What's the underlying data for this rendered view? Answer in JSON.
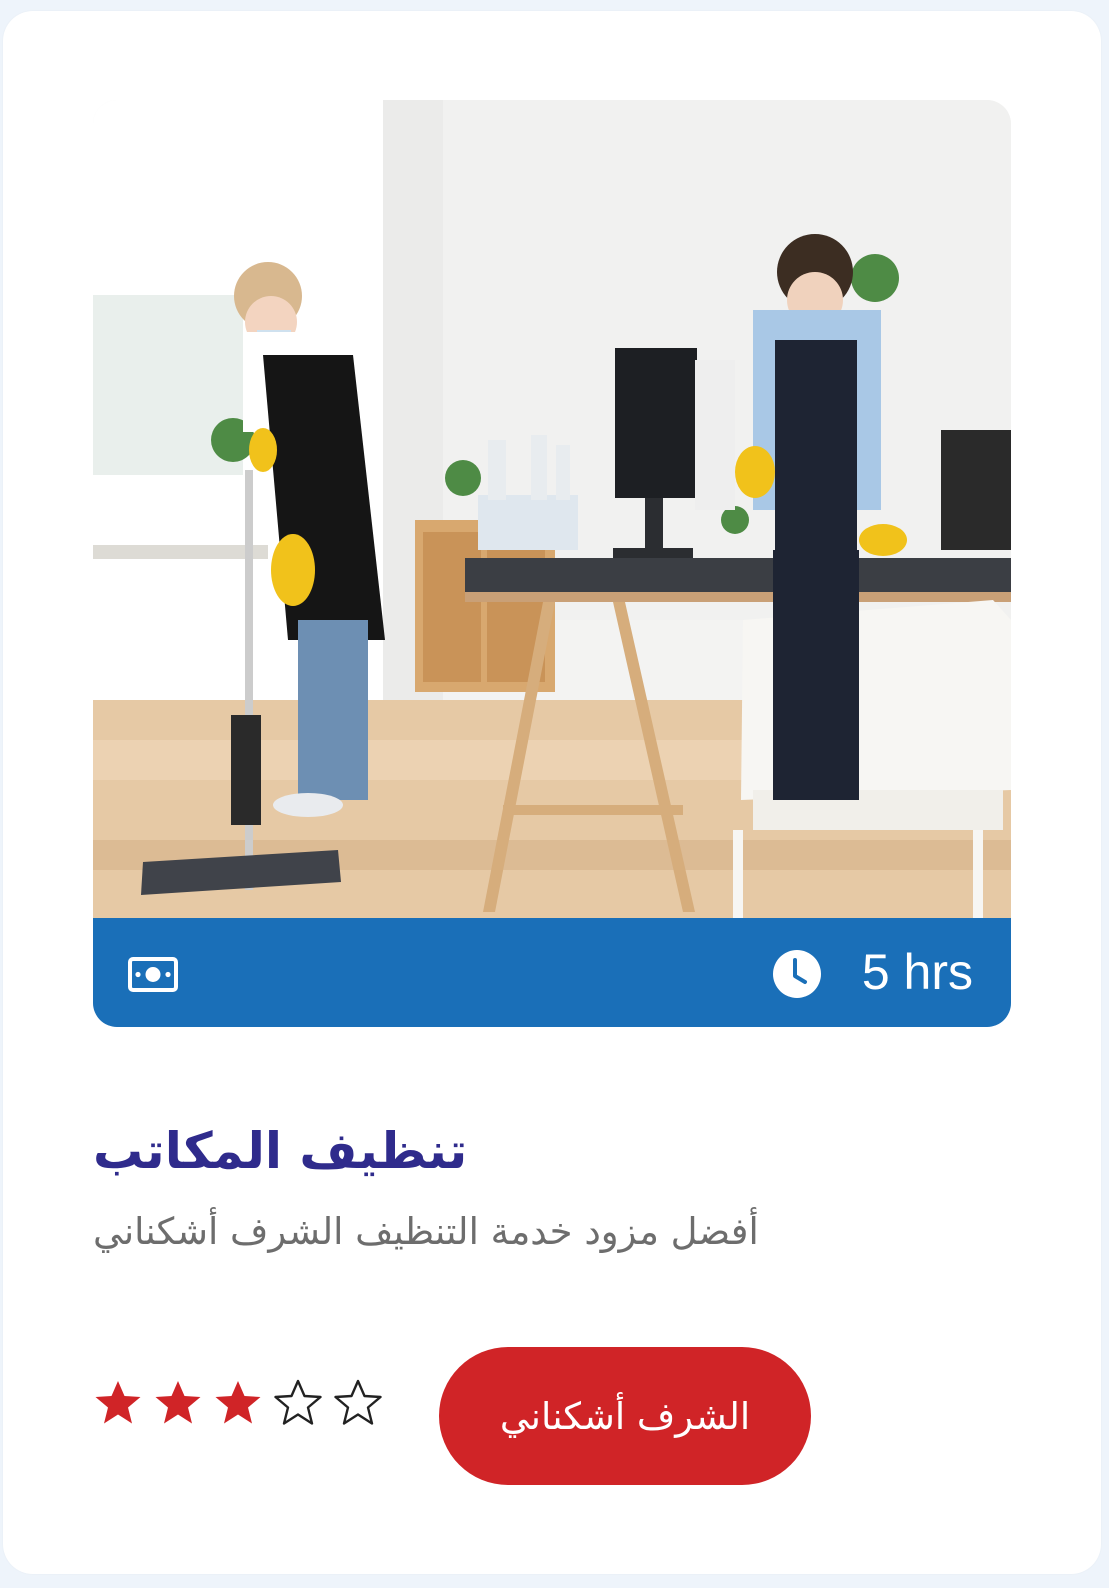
{
  "service": {
    "title": "تنظيف المكاتب",
    "description": "أفضل مزود خدمة التنظيف الشرف أشكناني",
    "duration": "5 hrs",
    "rating": 3,
    "rating_max": 5,
    "book_label": "الشرف أشكناني"
  },
  "icons": {
    "price": "money-icon",
    "duration": "clock-icon",
    "rating": "star-icon"
  },
  "colors": {
    "info_bar": "#1a6fb8",
    "title": "#2f2b8c",
    "button": "#d02427",
    "star_filled": "#d02427",
    "star_empty": "#222222"
  }
}
